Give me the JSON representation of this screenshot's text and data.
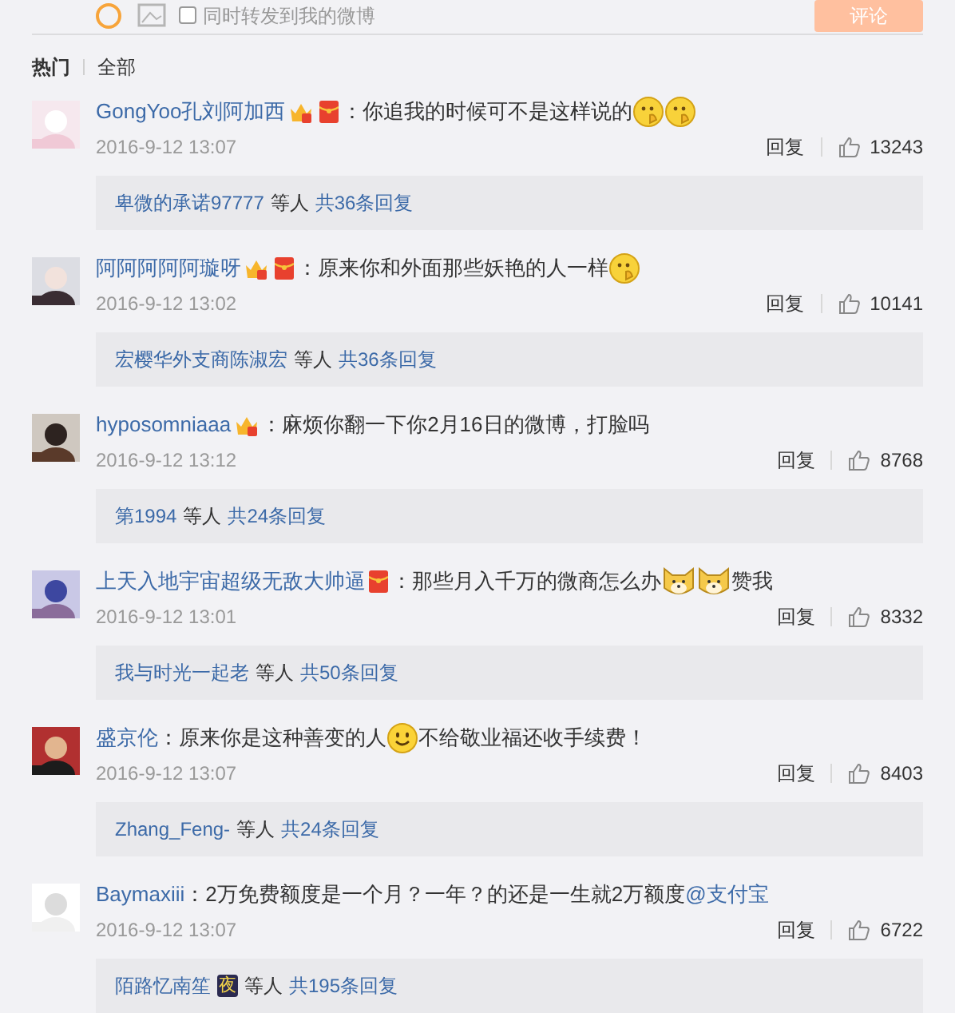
{
  "composer": {
    "repost_checkbox": {
      "label": "同时转发到我的微博",
      "checked": false
    },
    "submit_button": "评论"
  },
  "tabs": [
    {
      "label": "热门",
      "selected": true
    },
    {
      "label": "全部",
      "selected": false
    }
  ],
  "comments": [
    {
      "user": "GongYoo孔刘阿加西",
      "badges": [
        {
          "kind": "vip"
        },
        {
          "kind": "envelope"
        }
      ],
      "content": [
        {
          "kind": "text",
          "text": "：你追我的时候可不是这样说的"
        },
        {
          "kind": "shy"
        },
        {
          "kind": "shy"
        }
      ],
      "time": "2016-9-12 13:07",
      "reply": "回复",
      "likes": "13243",
      "replies": {
        "names": "卑微的承诺97777",
        "others": "等人",
        "count": "共36条回复"
      }
    },
    {
      "user": "阿阿阿阿阿璇呀",
      "badges": [
        {
          "kind": "vip"
        },
        {
          "kind": "envelope"
        }
      ],
      "content": [
        {
          "kind": "text",
          "text": "：原来你和外面那些妖艳的人一样"
        },
        {
          "kind": "shy"
        }
      ],
      "time": "2016-9-12 13:02",
      "reply": "回复",
      "likes": "10141",
      "replies": {
        "names": "宏樱华外支商陈淑宏",
        "others": "等人",
        "count": "共36条回复"
      }
    },
    {
      "user": "hyposomniaaa",
      "badges": [
        {
          "kind": "vip"
        }
      ],
      "content": [
        {
          "kind": "text",
          "text": "：麻烦你翻一下你2月16日的微博，打脸吗"
        }
      ],
      "time": "2016-9-12 13:12",
      "reply": "回复",
      "likes": "8768",
      "replies": {
        "names": "第1994",
        "others": "等人",
        "count": "共24条回复"
      }
    },
    {
      "user": "上天入地宇宙超级无敌大帅逼",
      "badges": [
        {
          "kind": "envelope"
        }
      ],
      "content": [
        {
          "kind": "text",
          "text": "：那些月入千万的微商怎么办"
        },
        {
          "kind": "doge"
        },
        {
          "kind": "doge"
        },
        {
          "kind": "text",
          "text": " 赞我"
        }
      ],
      "time": "2016-9-12 13:01",
      "reply": "回复",
      "likes": "8332",
      "replies": {
        "names": "我与时光一起老",
        "others": "等人",
        "count": "共50条回复"
      }
    },
    {
      "user": "盛京伦",
      "content": [
        {
          "kind": "text",
          "text": "：原来你是这种善变的人"
        },
        {
          "kind": "smile"
        },
        {
          "kind": "text",
          "text": "不给敬业福还收手续费！"
        }
      ],
      "time": "2016-9-12 13:07",
      "reply": "回复",
      "likes": "8403",
      "replies": {
        "names": "Zhang_Feng-",
        "others": "等人",
        "count": "共24条回复"
      }
    },
    {
      "user": "Baymaxiii",
      "content": [
        {
          "kind": "text",
          "text": "：2万免费额度是一个月？一年？的还是一生就2万额度"
        },
        {
          "kind": "link",
          "text": "@支付宝"
        }
      ],
      "time": "2016-9-12 13:07",
      "reply": "回复",
      "likes": "6722",
      "replies": {
        "names": "陌路忆南笙",
        "badge": "夜",
        "others": "等人",
        "count": "共195条回复"
      }
    }
  ]
}
